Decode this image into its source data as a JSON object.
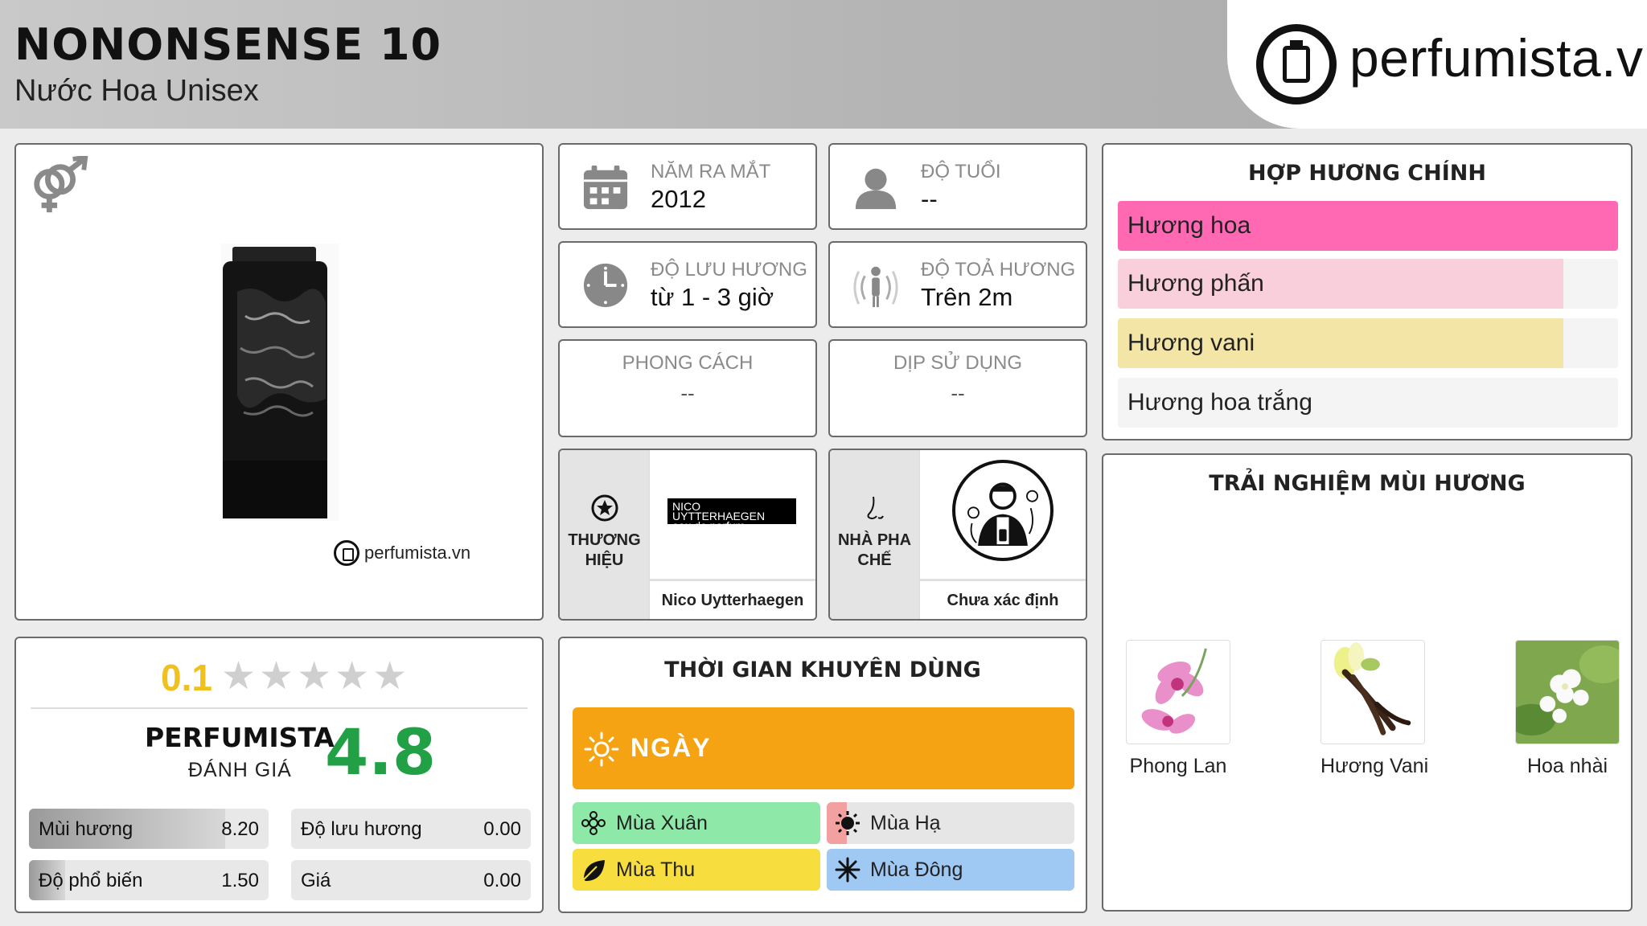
{
  "header": {
    "title": "NONONSENSE 10",
    "subtitle": "Nước Hoa Unisex",
    "logo_text": "perfumista.vn"
  },
  "image_card": {
    "gender_icon": "unisex-icon",
    "caption": "perfumista.vn"
  },
  "info": {
    "launch": {
      "label": "NĂM RA MẮT",
      "value": "2012",
      "icon": "calendar-icon"
    },
    "age": {
      "label": "ĐỘ TUỔI",
      "value": "--",
      "icon": "person-icon"
    },
    "longevity": {
      "label": "ĐỘ LƯU HƯƠNG",
      "value": "từ 1 - 3 giờ",
      "icon": "clock-icon"
    },
    "sillage": {
      "label": "ĐỘ TOẢ HƯƠNG",
      "value": "Trên 2m",
      "icon": "sillage-icon"
    },
    "style": {
      "label": "PHONG CÁCH",
      "value": "--"
    },
    "occasion": {
      "label": "DỊP SỬ DỤNG",
      "value": "--"
    }
  },
  "brand": {
    "label_line1": "THƯƠNG",
    "label_line2": "HIỆU",
    "logo_line1": "NICO UYTTERHAEGEN",
    "logo_line2": "eau de parfum",
    "name": "Nico Uytterhaegen"
  },
  "perfumer": {
    "label_line1": "NHÀ PHA",
    "label_line2": "CHẾ",
    "name": "Chưa xác định"
  },
  "accords": {
    "title": "HỢP HƯƠNG CHÍNH",
    "items": [
      {
        "label": "Hương hoa",
        "percent": 100,
        "color": "#ff69b4"
      },
      {
        "label": "Hương phấn",
        "percent": 89,
        "color": "#f9cfdc"
      },
      {
        "label": "Hương vani",
        "percent": 89,
        "color": "#f3e5a5"
      },
      {
        "label": "Hương hoa trắng",
        "percent": 0,
        "color": "#f4f4f4"
      }
    ]
  },
  "notes": {
    "title": "TRẢI NGHIỆM MÙI HƯƠNG",
    "items": [
      {
        "name": "Phong Lan"
      },
      {
        "name": "Hương Vani"
      },
      {
        "name": "Hoa nhài"
      }
    ]
  },
  "rating": {
    "user_score": "0.1",
    "stars_filled": 0,
    "perfumista_label": "PERFUMISTA",
    "perfumista_sub": "ĐÁNH GIÁ",
    "perfumista_score": "4.8",
    "metrics": [
      {
        "label": "Mùi hương",
        "value": "8.20",
        "fraction": 0.82
      },
      {
        "label": "Độ lưu hương",
        "value": "0.00",
        "fraction": 0
      },
      {
        "label": "Độ phổ biến",
        "value": "1.50",
        "fraction": 0.15
      },
      {
        "label": "Giá",
        "value": "0.00",
        "fraction": 0
      }
    ]
  },
  "time": {
    "title": "THỜI GIAN KHUYÊN DÙNG",
    "day": "NGÀY",
    "seasons": [
      {
        "label": "Mùa Xuân",
        "fraction": 1.0,
        "color": "#8ee8a8",
        "icon": "spring-flower-icon"
      },
      {
        "label": "Mùa Hạ",
        "fraction": 0.08,
        "color": "#f2a0a0",
        "icon": "sun-icon"
      },
      {
        "label": "Mùa Thu",
        "fraction": 1.0,
        "color": "#f7de3e",
        "icon": "leaf-icon"
      },
      {
        "label": "Mùa Đông",
        "fraction": 1.0,
        "color": "#9fc8f2",
        "icon": "snowflake-icon"
      }
    ]
  }
}
